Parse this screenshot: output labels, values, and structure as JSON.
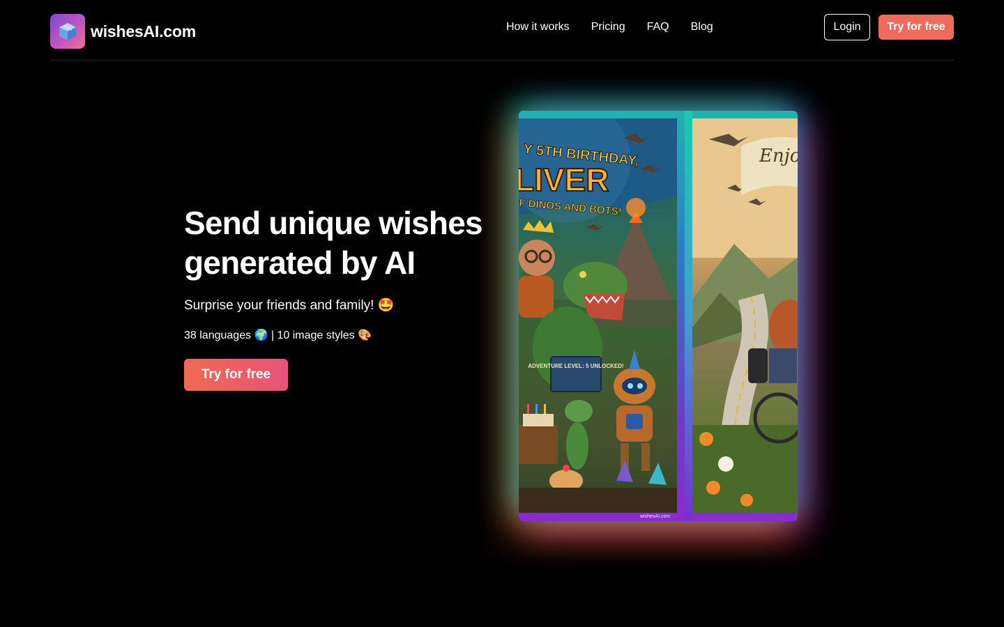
{
  "header": {
    "brand": "wishesAI.com",
    "nav": [
      "How it works",
      "Pricing",
      "FAQ",
      "Blog"
    ],
    "login_label": "Login",
    "try_label": "Try for free"
  },
  "hero": {
    "title": "Send unique wishes generated by AI",
    "subtitle": "Surprise your friends and family! 🤩",
    "meta": "38 languages 🌍 | 10 image styles 🎨",
    "cta_label": "Try for free"
  },
  "showcase": {
    "card1": {
      "banner_line1": "Y 5TH BIRTHDAY,",
      "banner_line2": "LIVER",
      "banner_line3": "F DINOS AND BOTS!",
      "sign": "ADVENTURE LEVEL: 5 UNLOCKED!"
    },
    "card2": {
      "banner": "Enjoy Happ"
    },
    "watermark": "wishesAI.com"
  }
}
